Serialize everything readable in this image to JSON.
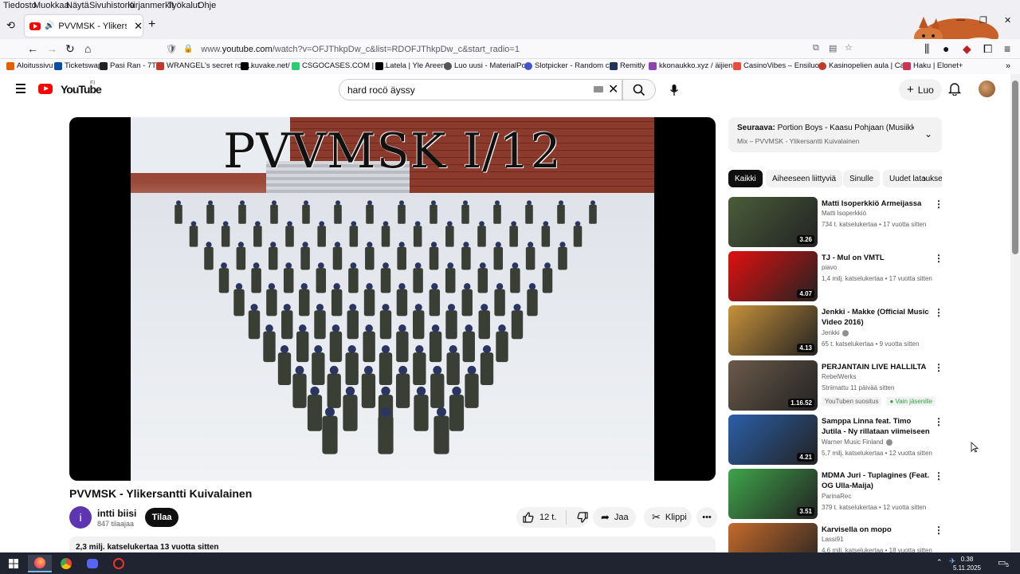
{
  "menubar": {
    "items": [
      "Tiedosto",
      "Muokkaa",
      "Näytä",
      "Sivuhistoria",
      "Kirjanmerkit",
      "Työkalut",
      "Ohje"
    ]
  },
  "tab": {
    "title": "PVVMSK - Ylikersantti K",
    "close": "✕",
    "new_tab": "+"
  },
  "window_controls": {
    "minimize": "—",
    "restore": "❐",
    "close": "✕"
  },
  "nav": {
    "url_prefix": "www.",
    "url_domain": "youtube.com",
    "url_rest": "/watch?v=OFJThkpDw_c&list=RDOFJThkpDw_c&start_radio=1"
  },
  "bookmarks": [
    {
      "label": "Aloitussivu",
      "color": "#e66000"
    },
    {
      "label": "Ticketswap",
      "color": "#0b4ea2"
    },
    {
      "label": "Pasi Ran - 7TV",
      "color": "#222"
    },
    {
      "label": "WRANGEL's secret roo...",
      "color": "#c0392b"
    },
    {
      "label": "kuvake.net/",
      "color": "#000"
    },
    {
      "label": "CSGOCASES.COM | O...",
      "color": "#2ecc71"
    },
    {
      "label": "Latela | Yle Areena",
      "color": "#000"
    },
    {
      "label": "Luo uusi - MaterialPot",
      "color": "#555"
    },
    {
      "label": "Slotpicker - Random c...",
      "color": "#4455cc"
    },
    {
      "label": "Remitly",
      "color": "#22335a"
    },
    {
      "label": "kkonaukko.xyz / äijien...",
      "color": "#8e44ad"
    },
    {
      "label": "CasinoVibes – Ensiluo...",
      "color": "#e74c3c"
    },
    {
      "label": "Kasinopelien aula | Ca...",
      "color": "#c0392b"
    },
    {
      "label": "Haku | Elonet+",
      "color": "#cc3355"
    }
  ],
  "yt": {
    "wordmark": "YouTube",
    "country": "FI",
    "search_query": "hard rocö äyssy",
    "create_label": "Luo"
  },
  "video": {
    "overlay_text": "PVVMSK I/12",
    "title": "PVVMSK - Ylikersantti Kuivalainen",
    "channel_initial": "i",
    "channel_name": "intti biisi",
    "subscribers": "847 tilaajaa",
    "subscribe_label": "Tilaa",
    "likes": "12 t.",
    "share_label": "Jaa",
    "clip_label": "Klippi",
    "more": "•••",
    "views_line": "2,3 milj. katselukertaa  13 vuotta sitten"
  },
  "up_next": {
    "label": "Seuraava:",
    "title": "Portion Boys - Kaasu Pohjaan (Musiikkia ...",
    "subtitle": "Mix – PVVMSK - Ylikersantti Kuivalainen",
    "chevron": "⌄"
  },
  "chips": [
    "Kaikki",
    "Aiheeseen liittyviä",
    "Sinulle",
    "Uudet lataukset"
  ],
  "recommendations": [
    {
      "title": "Matti Isoperkkiö Armeijassa",
      "channel": "Matti Isoperkkiö",
      "meta": "734 t. katselukertaa • 17 vuotta sitten",
      "duration": "3.26",
      "verified": false,
      "color": "#4a5d3a"
    },
    {
      "title": "TJ - Mul on VMTL",
      "channel": "piavo",
      "meta": "1,4 milj. katselukertaa • 17 vuotta sitten",
      "duration": "4.07",
      "verified": false,
      "color": "#e01010"
    },
    {
      "title": "Jenkki - Makke (Official Music Video 2016)",
      "channel": "Jenkki",
      "meta": "65 t. katselukertaa • 9 vuotta sitten",
      "duration": "4.13",
      "verified": true,
      "color": "#c7923a"
    },
    {
      "title": "PERJANTAIN LIVE HALLILTA",
      "channel": "RebelWerks",
      "meta": "Striimattu 11 päivää sitten",
      "duration": "1.16.52",
      "verified": false,
      "color": "#6b5a4a",
      "badges": [
        "YouTuben suositus",
        "● Vain jäsenille"
      ]
    },
    {
      "title": "Samppa Linna feat. Timo Jutila - Ny rillataan viimeiseen asti",
      "channel": "Warner Music Finland",
      "meta": "5,7 milj. katselukertaa • 12 vuotta sitten",
      "duration": "4.21",
      "verified": true,
      "color": "#2b5fa8"
    },
    {
      "title": "MDMA Juri - Tuplagines (Feat. OG Ulla-Maija)",
      "channel": "ParinaRec",
      "meta": "379 t. katselukertaa • 12 vuotta sitten",
      "duration": "3.51",
      "verified": false,
      "color": "#3fa44a"
    },
    {
      "title": "Karvisella on mopo",
      "channel": "Lassi91",
      "meta": "4,6 milj. katselukertaa • 18 vuotta sitten",
      "duration": "",
      "verified": false,
      "color": "#c56a2a"
    }
  ],
  "taskbar": {
    "time": "0.38",
    "date": "5.11.2025",
    "notifications": "5"
  }
}
